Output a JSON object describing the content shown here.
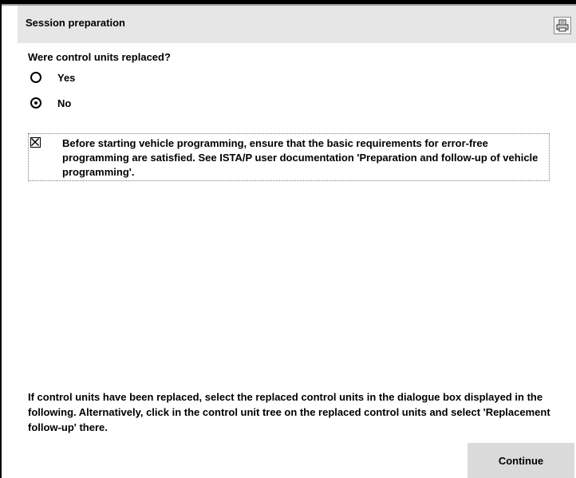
{
  "header": {
    "title": "Session preparation",
    "print_icon": "printer-icon"
  },
  "question": {
    "label": "Were control units replaced?",
    "options": [
      {
        "label": "Yes",
        "selected": false
      },
      {
        "label": "No",
        "selected": true
      }
    ]
  },
  "notice": {
    "checked": true,
    "text": "Before starting vehicle programming, ensure that the basic requirements for error-free programming are satisfied. See ISTA/P user documentation 'Preparation and follow-up of vehicle programming'."
  },
  "footer": {
    "text": "If control units have been replaced, select the replaced control units in the dialogue box displayed in the following. Alternatively, click in the control unit tree on the replaced control units and select 'Replacement follow-up' there.",
    "continue_label": "Continue"
  },
  "colors": {
    "header_bg": "#e6e6e6",
    "button_bg": "#dadada",
    "text": "#000000"
  }
}
